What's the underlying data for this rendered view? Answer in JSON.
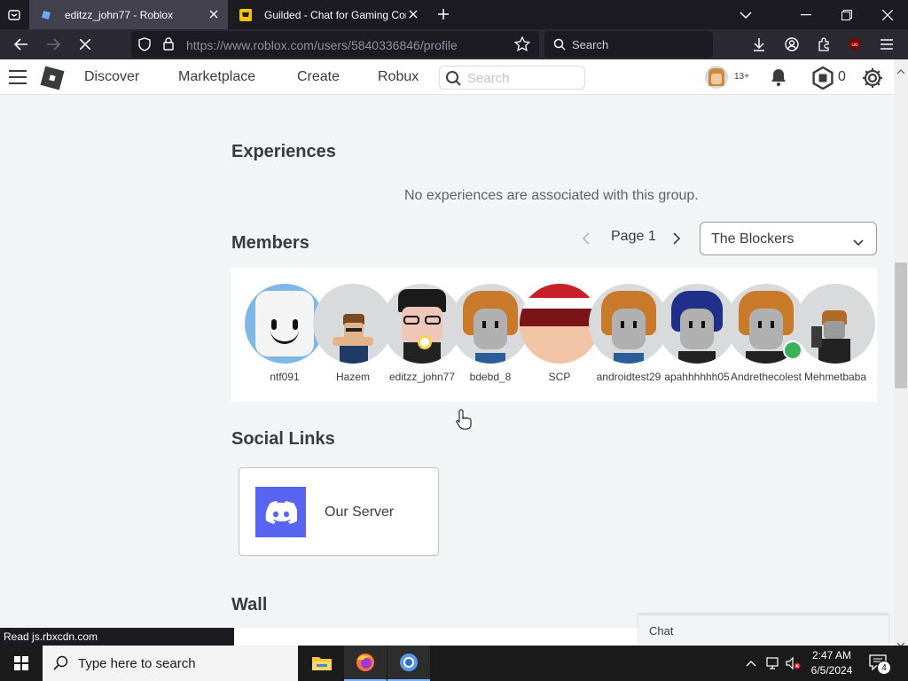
{
  "browser": {
    "tabs": [
      {
        "title": "editzz_john77 - Roblox",
        "active": true
      },
      {
        "title": "Guilded - Chat for Gaming Communities",
        "active": false
      }
    ],
    "url": "https://www.roblox.com/users/5840336846/profile",
    "search_placeholder": "Search",
    "status_text": "Read js.rbxcdn.com"
  },
  "roblox_header": {
    "nav": [
      "Discover",
      "Marketplace",
      "Create",
      "Robux"
    ],
    "search_placeholder": "Search",
    "age_badge": "13+",
    "robux_count": "0"
  },
  "experiences": {
    "heading": "Experiences",
    "empty_message": "No experiences are associated with this group."
  },
  "members": {
    "heading": "Members",
    "page_label": "Page 1",
    "role_dropdown": "The Blockers",
    "list": [
      {
        "name": "ntf091",
        "bg": "#7fb8e6",
        "skin": "#f2f2f2"
      },
      {
        "name": "Hazem",
        "bg": "#d8dadb",
        "skin": "#e3b48a"
      },
      {
        "name": "editzz_john77",
        "bg": "#d8dadb",
        "skin": "#f0c6b8"
      },
      {
        "name": "bdebd_8",
        "bg": "#d8dadb",
        "skin": "#b0b0b0"
      },
      {
        "name": "SCP",
        "bg": "#d8dadb",
        "skin": "#f0c4a4"
      },
      {
        "name": "androidtest29",
        "bg": "#d8dadb",
        "skin": "#b0b0b0"
      },
      {
        "name": "apahhhhhh05",
        "bg": "#d8dadb",
        "skin": "#b0b0b0"
      },
      {
        "name": "Andrethecolest",
        "bg": "#d8dadb",
        "skin": "#b0b0b0"
      },
      {
        "name": "Mehmetbaba",
        "bg": "#d8dadb",
        "skin": "#9a9a9a"
      }
    ]
  },
  "social_links": {
    "heading": "Social Links",
    "items": [
      {
        "label": "Our Server",
        "icon": "discord-icon",
        "color": "#5865f2"
      }
    ]
  },
  "wall": {
    "heading": "Wall"
  },
  "chat": {
    "label": "Chat"
  },
  "taskbar": {
    "search_placeholder": "Type here to search",
    "time": "2:47 AM",
    "date": "6/5/2024",
    "notification_count": "4"
  }
}
